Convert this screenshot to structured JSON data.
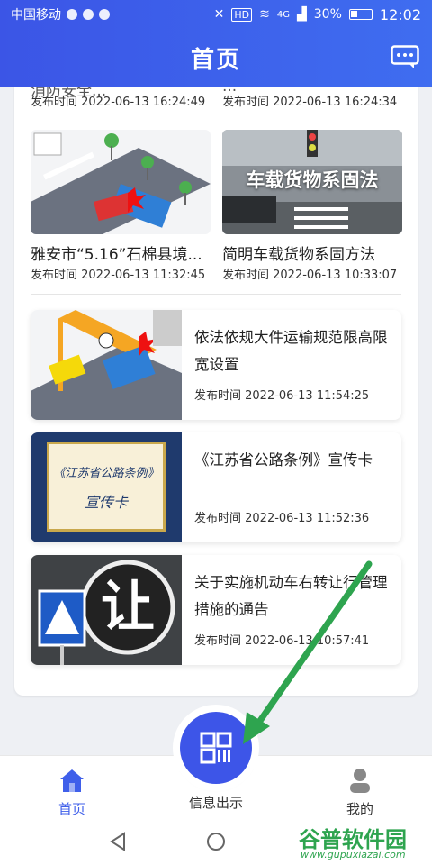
{
  "status_bar": {
    "carrier": "中国移动",
    "hd": "HD",
    "signal": "4G",
    "battery": "30%",
    "time": "12:02"
  },
  "header": {
    "title": "首页",
    "message_icon": "chat-bubble-icon"
  },
  "grid_top": [
    {
      "title": "消防安全...",
      "time": "发布时间  2022-06-13 16:24:49"
    },
    {
      "title": "...",
      "time": "发布时间  2022-06-13 16:24:34"
    }
  ],
  "grid_bottom": [
    {
      "title": "雅安市“5.16”石棉县境...",
      "time": "发布时间  2022-06-13 11:32:45"
    },
    {
      "title": "简明车载货物系固方法",
      "time": "发布时间  2022-06-13 10:33:07",
      "overlay": "车载货物系固法"
    }
  ],
  "list": [
    {
      "title": "依法依规大件运输规范限高限宽设置",
      "time": "发布时间  2022-06-13 11:54:25"
    },
    {
      "title": "《江苏省公路条例》宣传卡",
      "time": "发布时间  2022-06-13 11:52:36",
      "thumb_lines": [
        "《江苏省公路条例》",
        "宣传卡"
      ]
    },
    {
      "title": "关于实施机动车右转让行管理措施的通告",
      "time": "发布时间  2022-06-13 10:57:41",
      "thumb_char": "让"
    }
  ],
  "bottom_nav": {
    "home": "首页",
    "center": "信息出示",
    "mine": "我的"
  },
  "watermark": {
    "big": "谷普软件园",
    "small": "www.gupuxiazai.com"
  },
  "colors": {
    "primary": "#3d55e8",
    "arrow": "#2ea44f"
  }
}
